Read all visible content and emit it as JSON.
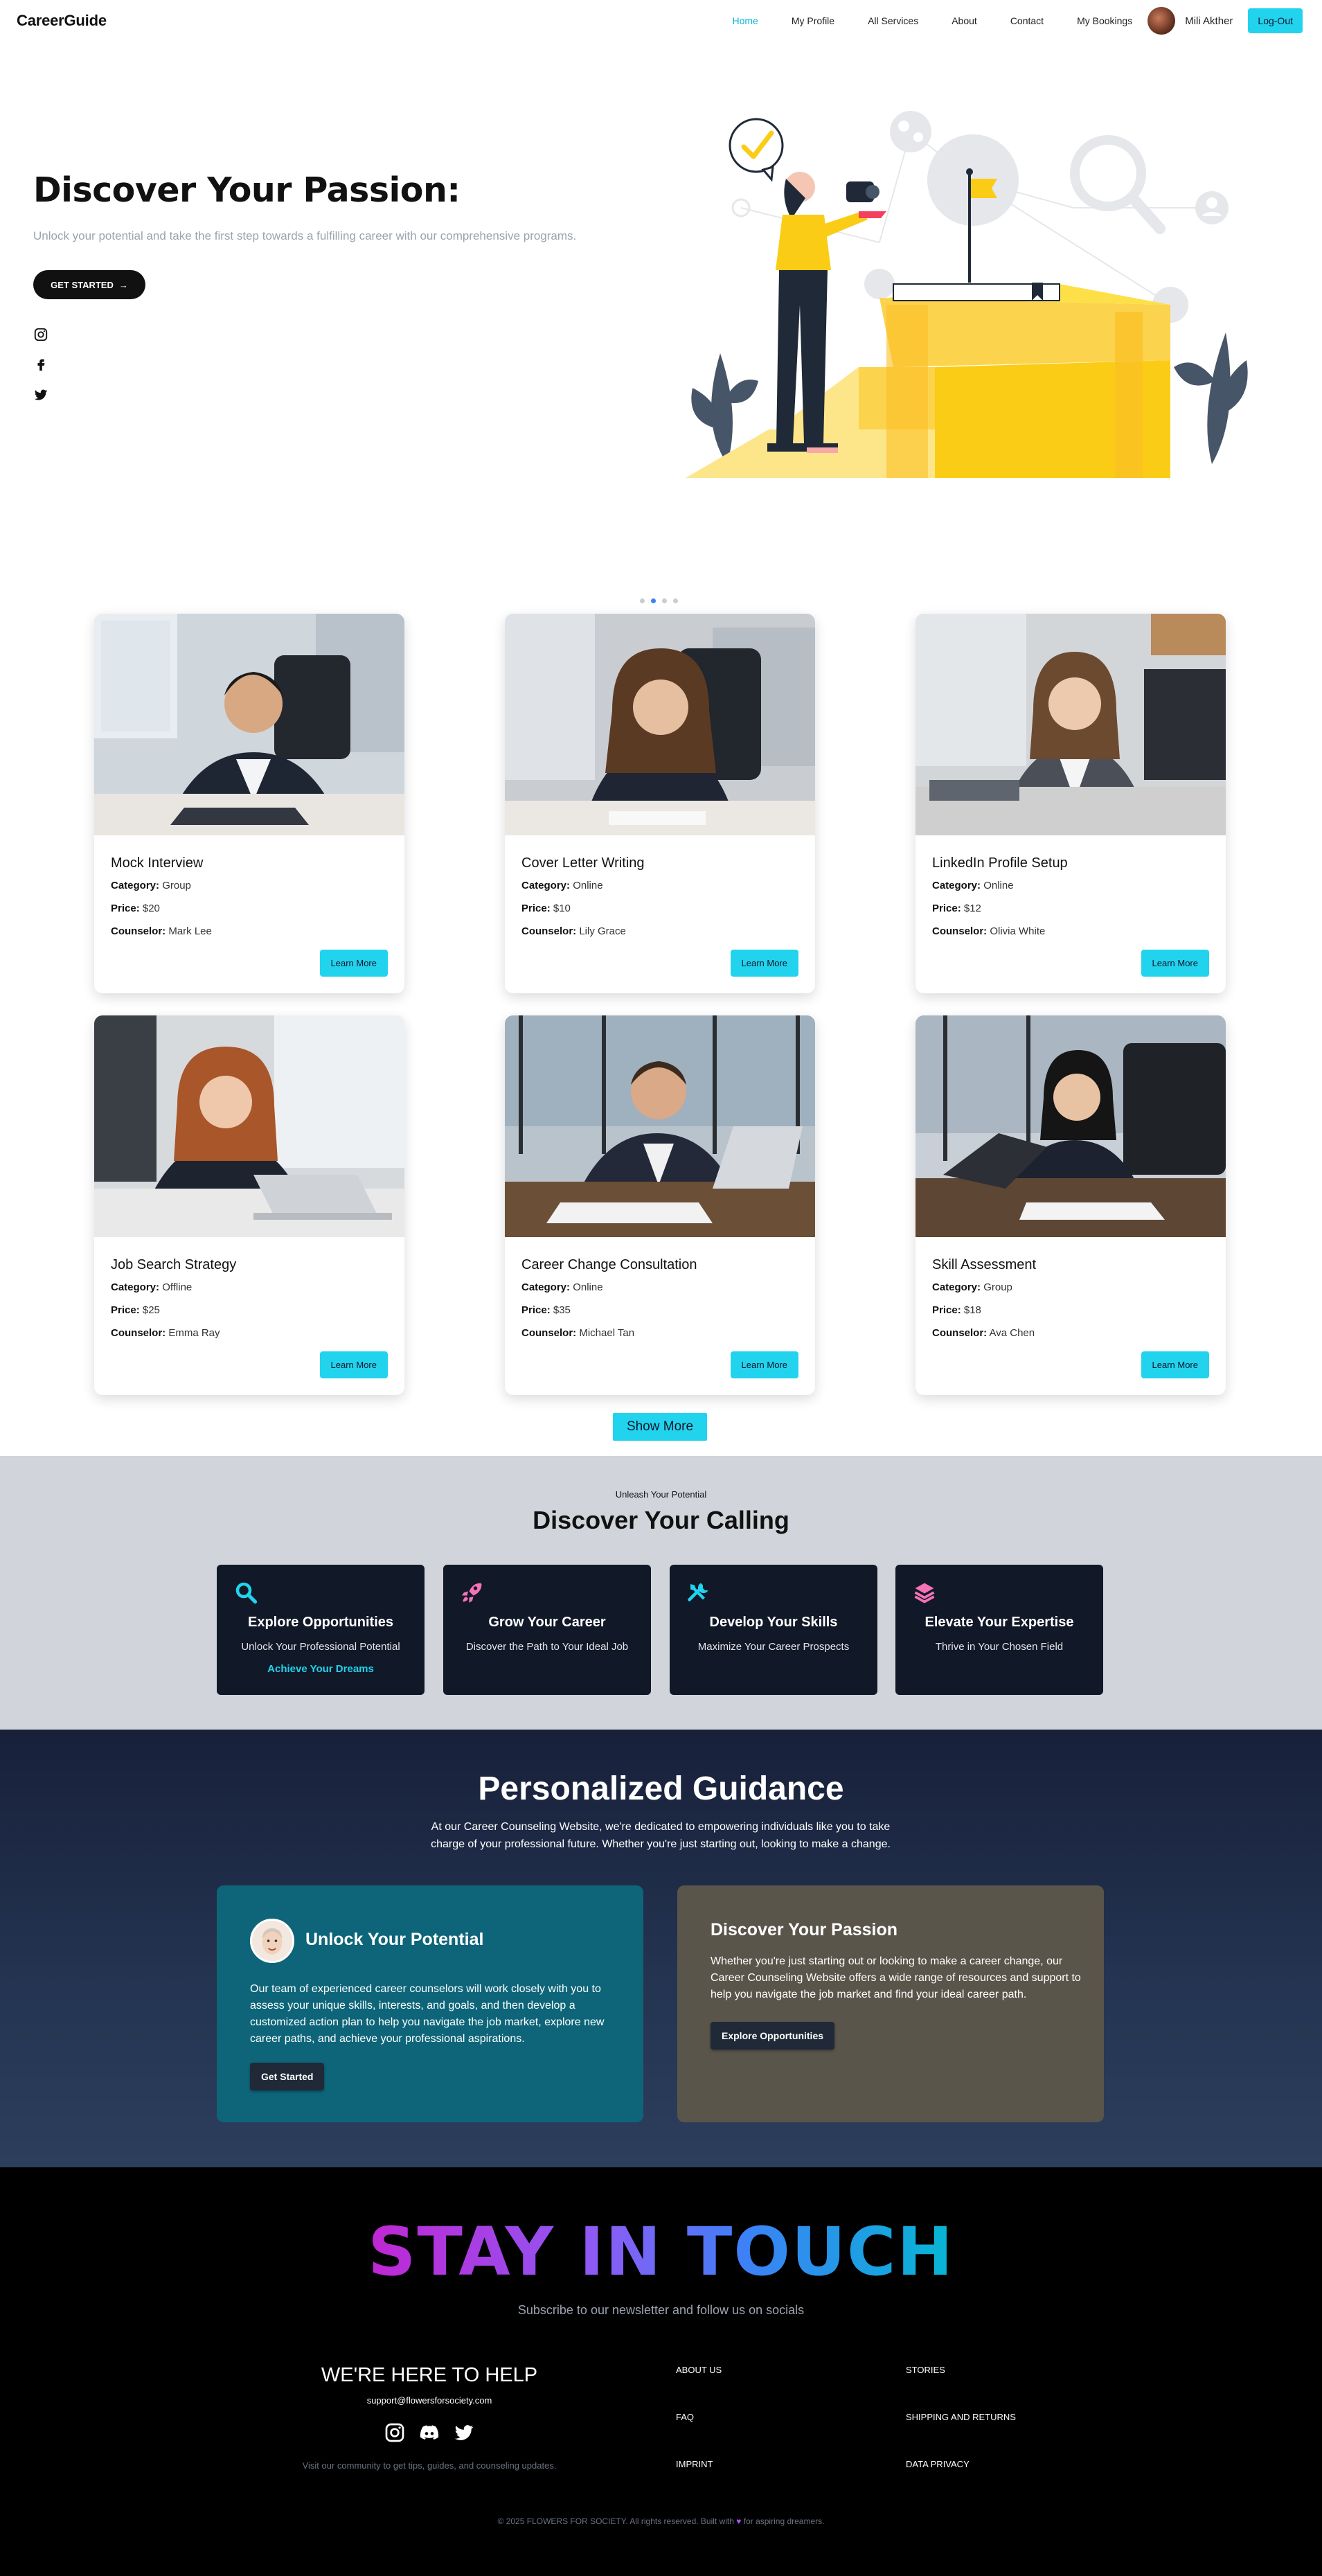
{
  "nav": {
    "brand": "CareerGuide",
    "links": [
      "Home",
      "My Profile",
      "All Services",
      "About",
      "Contact",
      "My Bookings"
    ],
    "active": "Home",
    "user_name": "Mili Akther",
    "logout_label": "Log-Out"
  },
  "hero": {
    "title": "Discover Your Passion:",
    "subtitle": "Unlock your potential and take the first step towards a fulfilling career with our comprehensive programs.",
    "cta": "GET STARTED",
    "cta_arrow": "→",
    "socials": [
      "instagram-icon",
      "facebook-icon",
      "twitter-icon"
    ]
  },
  "carousel": {
    "dots": 4,
    "active_dot": 2
  },
  "services": [
    {
      "title": "Mock Interview",
      "category": "Group",
      "price": "$20",
      "counselor": "Mark Lee"
    },
    {
      "title": "Cover Letter Writing",
      "category": "Online",
      "price": "$10",
      "counselor": "Lily Grace"
    },
    {
      "title": "LinkedIn Profile Setup",
      "category": "Online",
      "price": "$12",
      "counselor": "Olivia White"
    },
    {
      "title": "Job Search Strategy",
      "category": "Offline",
      "price": "$25",
      "counselor": "Emma Ray"
    },
    {
      "title": "Career Change Consultation",
      "category": "Online",
      "price": "$35",
      "counselor": "Michael Tan"
    },
    {
      "title": "Skill Assessment",
      "category": "Group",
      "price": "$18",
      "counselor": "Ava Chen"
    }
  ],
  "service_labels": {
    "category": "Category:",
    "price": "Price:",
    "counselor": "Counselor:",
    "learn_more": "Learn More"
  },
  "show_more": "Show More",
  "calling": {
    "kicker": "Unleash Your Potential",
    "title": "Discover Your Calling",
    "boxes": [
      {
        "icon": "search-icon",
        "title": "Explore Opportunities",
        "sub": "Unlock Your Professional Potential",
        "link": "Achieve Your Dreams",
        "color": "#22d3ee"
      },
      {
        "icon": "rocket-icon",
        "title": "Grow Your Career",
        "sub": "Discover the Path to Your Ideal Job",
        "color": "#f472b6"
      },
      {
        "icon": "tools-icon",
        "title": "Develop Your Skills",
        "sub": "Maximize Your Career Prospects",
        "color": "#22d3ee"
      },
      {
        "icon": "layers-icon",
        "title": "Elevate Your Expertise",
        "sub": "Thrive in Your Chosen Field",
        "color": "#f472b6"
      }
    ]
  },
  "guidance": {
    "title": "Personalized Guidance",
    "subtitle": "At our Career Counseling Website, we're dedicated to empowering individuals like you to take charge of your professional future. Whether you're just starting out, looking to make a change.",
    "left": {
      "title": "Unlock Your Potential",
      "text": "Our team of experienced career counselors will work closely with you to assess your unique skills, interests, and goals, and then develop a customized action plan to help you navigate the job market, explore new career paths, and achieve your professional aspirations.",
      "button": "Get Started"
    },
    "right": {
      "title": "Discover Your Passion",
      "text": "Whether you're just starting out or looking to make a career change, our Career Counseling Website offers a wide range of resources and support to help you navigate the job market and find your ideal career path.",
      "button": "Explore Opportunities"
    }
  },
  "footer": {
    "headline": "STAY IN TOUCH",
    "subline": "Subscribe to our newsletter and follow us on socials",
    "help_title": "WE'RE HERE TO HELP",
    "email": "support@flowersforsociety.com",
    "social_icons": [
      "instagram-icon",
      "discord-icon",
      "twitter-icon"
    ],
    "note": "Visit our community to get tips, guides, and counseling updates.",
    "links_col1": [
      "ABOUT US",
      "FAQ",
      "IMPRINT"
    ],
    "links_col2": [
      "STORIES",
      "SHIPPING AND RETURNS",
      "DATA PRIVACY"
    ],
    "copyright_pre": "© 2025 FLOWERS FOR SOCIETY. All rights reserved. Built with",
    "copyright_post": "for aspiring dreamers."
  }
}
